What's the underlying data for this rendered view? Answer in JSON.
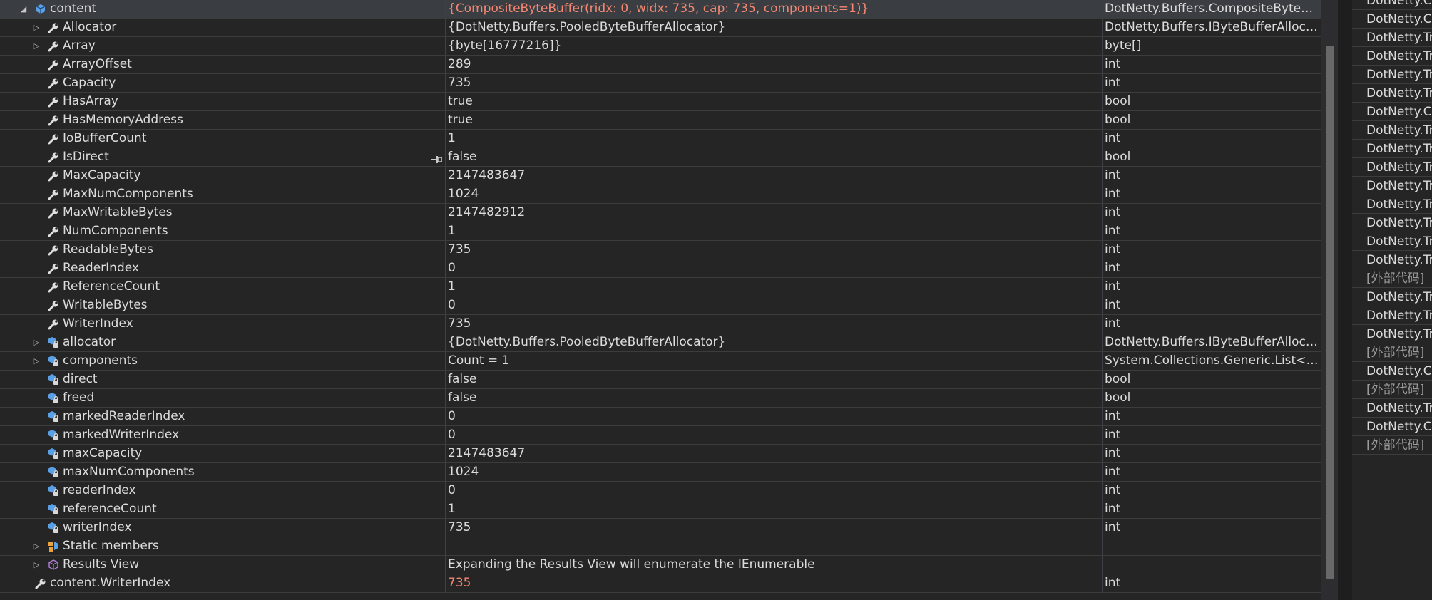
{
  "watch": {
    "rows": [
      {
        "indent": 0,
        "expander": "expanded",
        "icon": "object-icon",
        "name": "content",
        "value": "{CompositeByteBuffer(ridx: 0, widx: 735, cap: 735, components=1)}",
        "type": "DotNetty.Buffers.CompositeByteBuff...",
        "changed": true,
        "selected": true
      },
      {
        "indent": 1,
        "expander": "collapsed",
        "icon": "property-wrench-icon",
        "name": "Allocator",
        "value": "{DotNetty.Buffers.PooledByteBufferAllocator}",
        "type": "DotNetty.Buffers.IByteBufferAllocato..."
      },
      {
        "indent": 1,
        "expander": "collapsed",
        "icon": "property-wrench-icon",
        "name": "Array",
        "value": "{byte[16777216]}",
        "type": "byte[]"
      },
      {
        "indent": 1,
        "expander": "none",
        "icon": "property-wrench-icon",
        "name": "ArrayOffset",
        "value": "289",
        "type": "int"
      },
      {
        "indent": 1,
        "expander": "none",
        "icon": "property-wrench-icon",
        "name": "Capacity",
        "value": "735",
        "type": "int"
      },
      {
        "indent": 1,
        "expander": "none",
        "icon": "property-wrench-icon",
        "name": "HasArray",
        "value": "true",
        "type": "bool"
      },
      {
        "indent": 1,
        "expander": "none",
        "icon": "property-wrench-icon",
        "name": "HasMemoryAddress",
        "value": "true",
        "type": "bool"
      },
      {
        "indent": 1,
        "expander": "none",
        "icon": "property-wrench-icon",
        "name": "IoBufferCount",
        "value": "1",
        "type": "int"
      },
      {
        "indent": 1,
        "expander": "none",
        "icon": "property-wrench-icon",
        "name": "IsDirect",
        "value": "false",
        "type": "bool"
      },
      {
        "indent": 1,
        "expander": "none",
        "icon": "property-wrench-icon",
        "name": "MaxCapacity",
        "value": "2147483647",
        "type": "int"
      },
      {
        "indent": 1,
        "expander": "none",
        "icon": "property-wrench-icon",
        "name": "MaxNumComponents",
        "value": "1024",
        "type": "int"
      },
      {
        "indent": 1,
        "expander": "none",
        "icon": "property-wrench-icon",
        "name": "MaxWritableBytes",
        "value": "2147482912",
        "type": "int"
      },
      {
        "indent": 1,
        "expander": "none",
        "icon": "property-wrench-icon",
        "name": "NumComponents",
        "value": "1",
        "type": "int"
      },
      {
        "indent": 1,
        "expander": "none",
        "icon": "property-wrench-icon",
        "name": "ReadableBytes",
        "value": "735",
        "type": "int"
      },
      {
        "indent": 1,
        "expander": "none",
        "icon": "property-wrench-icon",
        "name": "ReaderIndex",
        "value": "0",
        "type": "int"
      },
      {
        "indent": 1,
        "expander": "none",
        "icon": "property-wrench-icon",
        "name": "ReferenceCount",
        "value": "1",
        "type": "int"
      },
      {
        "indent": 1,
        "expander": "none",
        "icon": "property-wrench-icon",
        "name": "WritableBytes",
        "value": "0",
        "type": "int"
      },
      {
        "indent": 1,
        "expander": "none",
        "icon": "property-wrench-icon",
        "name": "WriterIndex",
        "value": "735",
        "type": "int"
      },
      {
        "indent": 1,
        "expander": "collapsed",
        "icon": "private-field-icon",
        "name": "allocator",
        "value": "{DotNetty.Buffers.PooledByteBufferAllocator}",
        "type": "DotNetty.Buffers.IByteBufferAllocato..."
      },
      {
        "indent": 1,
        "expander": "collapsed",
        "icon": "private-field-icon",
        "name": "components",
        "value": "Count = 1",
        "type": "System.Collections.Generic.List<Dot..."
      },
      {
        "indent": 1,
        "expander": "none",
        "icon": "private-field-icon",
        "name": "direct",
        "value": "false",
        "type": "bool"
      },
      {
        "indent": 1,
        "expander": "none",
        "icon": "private-field-icon",
        "name": "freed",
        "value": "false",
        "type": "bool"
      },
      {
        "indent": 1,
        "expander": "none",
        "icon": "private-field-icon",
        "name": "markedReaderIndex",
        "value": "0",
        "type": "int"
      },
      {
        "indent": 1,
        "expander": "none",
        "icon": "private-field-icon",
        "name": "markedWriterIndex",
        "value": "0",
        "type": "int"
      },
      {
        "indent": 1,
        "expander": "none",
        "icon": "private-field-icon",
        "name": "maxCapacity",
        "value": "2147483647",
        "type": "int"
      },
      {
        "indent": 1,
        "expander": "none",
        "icon": "private-field-icon",
        "name": "maxNumComponents",
        "value": "1024",
        "type": "int"
      },
      {
        "indent": 1,
        "expander": "none",
        "icon": "private-field-icon",
        "name": "readerIndex",
        "value": "0",
        "type": "int"
      },
      {
        "indent": 1,
        "expander": "none",
        "icon": "private-field-icon",
        "name": "referenceCount",
        "value": "1",
        "type": "int"
      },
      {
        "indent": 1,
        "expander": "none",
        "icon": "private-field-icon",
        "name": "writerIndex",
        "value": "735",
        "type": "int"
      },
      {
        "indent": 1,
        "expander": "collapsed",
        "icon": "static-members-icon",
        "name": "Static members",
        "value": "",
        "type": ""
      },
      {
        "indent": 1,
        "expander": "collapsed",
        "icon": "results-view-icon",
        "name": "Results View",
        "value": "Expanding the Results View will enumerate the IEnumerable",
        "type": ""
      },
      {
        "indent": 0,
        "expander": "none",
        "icon": "property-wrench-icon",
        "name": "content.WriterIndex",
        "value": "735",
        "type": "int",
        "changed": true
      }
    ]
  },
  "call_stack": {
    "rows": [
      {
        "text": "DotNetty.C",
        "ext": false
      },
      {
        "text": "DotNetty.C",
        "ext": false
      },
      {
        "text": "DotNetty.Tr",
        "ext": false
      },
      {
        "text": "DotNetty.Tr",
        "ext": false
      },
      {
        "text": "DotNetty.Tr",
        "ext": false
      },
      {
        "text": "DotNetty.Tr",
        "ext": false
      },
      {
        "text": "DotNetty.C",
        "ext": false
      },
      {
        "text": "DotNetty.Tr",
        "ext": false
      },
      {
        "text": "DotNetty.Tr",
        "ext": false
      },
      {
        "text": "DotNetty.Tr",
        "ext": false
      },
      {
        "text": "DotNetty.Tr",
        "ext": false
      },
      {
        "text": "DotNetty.Tr",
        "ext": false
      },
      {
        "text": "DotNetty.Tr",
        "ext": false
      },
      {
        "text": "DotNetty.Tr",
        "ext": false
      },
      {
        "text": "DotNetty.Tr",
        "ext": false
      },
      {
        "text": "[外部代码]",
        "ext": true
      },
      {
        "text": "DotNetty.Tr",
        "ext": false
      },
      {
        "text": "DotNetty.Tr",
        "ext": false
      },
      {
        "text": "DotNetty.Tr",
        "ext": false
      },
      {
        "text": "[外部代码]",
        "ext": true
      },
      {
        "text": "DotNetty.C",
        "ext": false
      },
      {
        "text": "[外部代码]",
        "ext": true
      },
      {
        "text": "DotNetty.Tr",
        "ext": false
      },
      {
        "text": "DotNetty.C",
        "ext": false
      },
      {
        "text": "[外部代码]",
        "ext": true
      }
    ]
  },
  "colors": {
    "background": "#252526",
    "text": "#dcdcdc",
    "changed_value": "#f48771",
    "selected_row": "#3a3d41",
    "grid_line": "#3c3c3c"
  }
}
